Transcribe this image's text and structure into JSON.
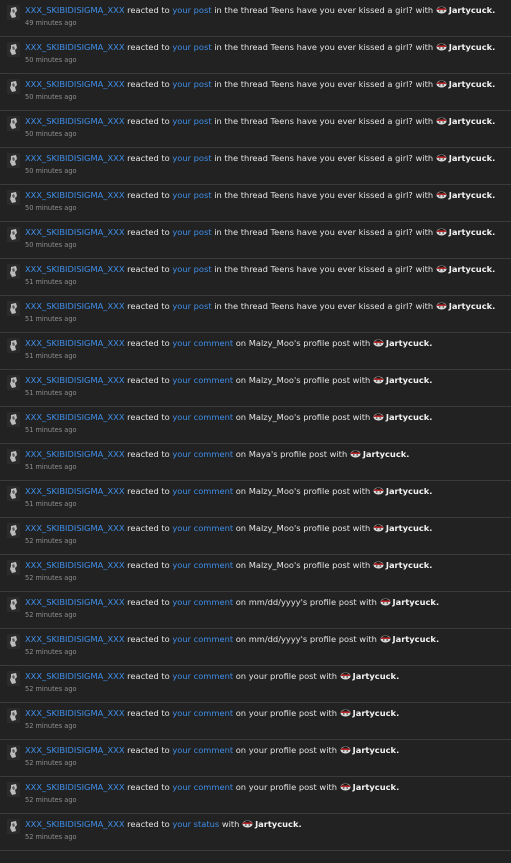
{
  "notifications": {
    "reacted_to": "reacted to",
    "with": "with",
    "reaction_name": "Jartycuck.",
    "items": [
      {
        "user": "XXX_SKIBIDISIGMA_XXX",
        "target": "your post",
        "context": "in the thread Teens have you ever kissed a girl?",
        "time": "49 minutes ago"
      },
      {
        "user": "XXX_SKIBIDISIGMA_XXX",
        "target": "your post",
        "context": "in the thread Teens have you ever kissed a girl?",
        "time": "50 minutes ago"
      },
      {
        "user": "XXX_SKIBIDISIGMA_XXX",
        "target": "your post",
        "context": "in the thread Teens have you ever kissed a girl?",
        "time": "50 minutes ago"
      },
      {
        "user": "XXX_SKIBIDISIGMA_XXX",
        "target": "your post",
        "context": "in the thread Teens have you ever kissed a girl?",
        "time": "50 minutes ago"
      },
      {
        "user": "XXX_SKIBIDISIGMA_XXX",
        "target": "your post",
        "context": "in the thread Teens have you ever kissed a girl?",
        "time": "50 minutes ago"
      },
      {
        "user": "XXX_SKIBIDISIGMA_XXX",
        "target": "your post",
        "context": "in the thread Teens have you ever kissed a girl?",
        "time": "50 minutes ago"
      },
      {
        "user": "XXX_SKIBIDISIGMA_XXX",
        "target": "your post",
        "context": "in the thread Teens have you ever kissed a girl?",
        "time": "50 minutes ago"
      },
      {
        "user": "XXX_SKIBIDISIGMA_XXX",
        "target": "your post",
        "context": "in the thread Teens have you ever kissed a girl?",
        "time": "51 minutes ago"
      },
      {
        "user": "XXX_SKIBIDISIGMA_XXX",
        "target": "your post",
        "context": "in the thread Teens have you ever kissed a girl?",
        "time": "51 minutes ago"
      },
      {
        "user": "XXX_SKIBIDISIGMA_XXX",
        "target": "your comment",
        "context": "on Malzy_Moo's profile post",
        "time": "51 minutes ago"
      },
      {
        "user": "XXX_SKIBIDISIGMA_XXX",
        "target": "your comment",
        "context": "on Malzy_Moo's profile post",
        "time": "51 minutes ago"
      },
      {
        "user": "XXX_SKIBIDISIGMA_XXX",
        "target": "your comment",
        "context": "on Malzy_Moo's profile post",
        "time": "51 minutes ago"
      },
      {
        "user": "XXX_SKIBIDISIGMA_XXX",
        "target": "your comment",
        "context": "on Maya's profile post",
        "time": "51 minutes ago"
      },
      {
        "user": "XXX_SKIBIDISIGMA_XXX",
        "target": "your comment",
        "context": "on Malzy_Moo's profile post",
        "time": "51 minutes ago"
      },
      {
        "user": "XXX_SKIBIDISIGMA_XXX",
        "target": "your comment",
        "context": "on Malzy_Moo's profile post",
        "time": "52 minutes ago"
      },
      {
        "user": "XXX_SKIBIDISIGMA_XXX",
        "target": "your comment",
        "context": "on Malzy_Moo's profile post",
        "time": "52 minutes ago"
      },
      {
        "user": "XXX_SKIBIDISIGMA_XXX",
        "target": "your comment",
        "context": "on mm/dd/yyyy's profile post",
        "time": "52 minutes ago"
      },
      {
        "user": "XXX_SKIBIDISIGMA_XXX",
        "target": "your comment",
        "context": "on mm/dd/yyyy's profile post",
        "time": "52 minutes ago"
      },
      {
        "user": "XXX_SKIBIDISIGMA_XXX",
        "target": "your comment",
        "context": "on your profile post",
        "time": "52 minutes ago"
      },
      {
        "user": "XXX_SKIBIDISIGMA_XXX",
        "target": "your comment",
        "context": "on your profile post",
        "time": "52 minutes ago"
      },
      {
        "user": "XXX_SKIBIDISIGMA_XXX",
        "target": "your comment",
        "context": "on your profile post",
        "time": "52 minutes ago"
      },
      {
        "user": "XXX_SKIBIDISIGMA_XXX",
        "target": "your comment",
        "context": "on your profile post",
        "time": "52 minutes ago"
      },
      {
        "user": "XXX_SKIBIDISIGMA_XXX",
        "target": "your status",
        "context": "",
        "time": "52 minutes ago"
      }
    ]
  },
  "colors": {
    "background": "#222222",
    "separator": "#3b3b3b",
    "link": "#3f8ee8",
    "text": "#e4e4e4",
    "timestamp": "#8f8f8f"
  },
  "icons": {
    "avatar": "avatar-icon",
    "reaction": "jartycuck-reaction-icon"
  }
}
